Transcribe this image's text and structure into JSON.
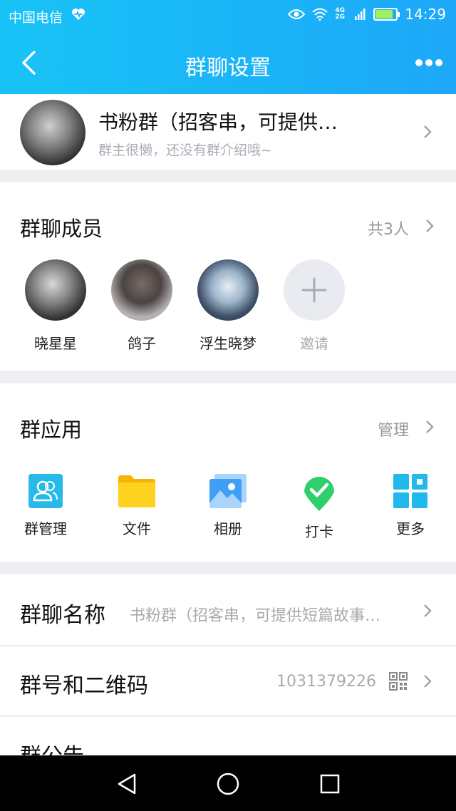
{
  "status": {
    "carrier": "中国电信",
    "net": "4G",
    "net2": "2G",
    "time": "14:29"
  },
  "nav": {
    "title": "群聊设置"
  },
  "group": {
    "name": "书粉群（招客串，可提供…",
    "desc": "群主很懒，还没有群介绍哦~"
  },
  "members": {
    "title": "群聊成员",
    "count": "共3人",
    "list": [
      {
        "name": "晓星星"
      },
      {
        "name": "鸽子"
      },
      {
        "name": "浮生晓梦"
      }
    ],
    "invite": "邀请"
  },
  "apps": {
    "title": "群应用",
    "manage": "管理",
    "items": [
      {
        "label": "群管理",
        "icon": "group-manage-icon"
      },
      {
        "label": "文件",
        "icon": "folder-icon"
      },
      {
        "label": "相册",
        "icon": "album-icon"
      },
      {
        "label": "打卡",
        "icon": "checkin-icon"
      },
      {
        "label": "更多",
        "icon": "more-grid-icon"
      }
    ]
  },
  "rows": {
    "name_label": "群聊名称",
    "name_value": "书粉群（招客串，可提供短篇故事…",
    "number_label": "群号和二维码",
    "number_value": "1031379226",
    "notice_label": "群公告"
  },
  "colors": {
    "accent": "#1da8f8",
    "accent_light": "#17c3f6",
    "checkin": "#2fcf6c",
    "folder": "#ffcc1a"
  }
}
